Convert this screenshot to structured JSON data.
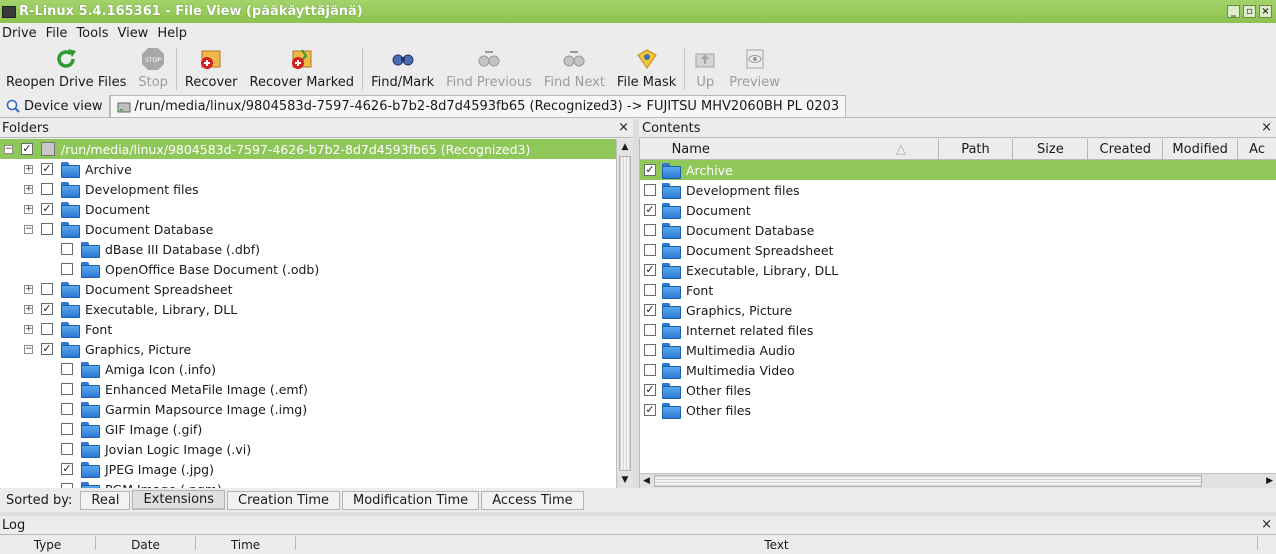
{
  "window": {
    "title": "R-Linux 5.4.165361 - File View (pääkäyttäjänä)"
  },
  "menu": [
    "Drive",
    "File",
    "Tools",
    "View",
    "Help"
  ],
  "toolbar": {
    "reopen": "Reopen Drive Files",
    "stop": "Stop",
    "recover": "Recover",
    "recover_marked": "Recover Marked",
    "find_mark": "Find/Mark",
    "find_previous": "Find Previous",
    "find_next": "Find Next",
    "file_mask": "File Mask",
    "up": "Up",
    "preview": "Preview"
  },
  "tabs": {
    "device_view": "Device view",
    "file_view": "/run/media/linux/9804583d-7597-4626-b7b2-8d7d4593fb65 (Recognized3) -> FUJITSU MHV2060BH PL 0203"
  },
  "folders": {
    "title": "Folders",
    "root": "/run/media/linux/9804583d-7597-4626-b7b2-8d7d4593fb65 (Recognized3)",
    "items": [
      {
        "label": "Archive",
        "level": 1,
        "expander": "+",
        "checked": true
      },
      {
        "label": "Development files",
        "level": 1,
        "expander": "+",
        "checked": false
      },
      {
        "label": "Document",
        "level": 1,
        "expander": "+",
        "checked": true
      },
      {
        "label": "Document Database",
        "level": 1,
        "expander": "-",
        "checked": false
      },
      {
        "label": "dBase III Database (.dbf)",
        "level": 2,
        "expander": "",
        "checked": false
      },
      {
        "label": "OpenOffice Base Document (.odb)",
        "level": 2,
        "expander": "",
        "checked": false
      },
      {
        "label": "Document Spreadsheet",
        "level": 1,
        "expander": "+",
        "checked": false
      },
      {
        "label": "Executable, Library, DLL",
        "level": 1,
        "expander": "+",
        "checked": true
      },
      {
        "label": "Font",
        "level": 1,
        "expander": "+",
        "checked": false
      },
      {
        "label": "Graphics, Picture",
        "level": 1,
        "expander": "-",
        "checked": true
      },
      {
        "label": "Amiga Icon (.info)",
        "level": 2,
        "expander": "",
        "checked": false
      },
      {
        "label": "Enhanced MetaFile Image (.emf)",
        "level": 2,
        "expander": "",
        "checked": false
      },
      {
        "label": "Garmin Mapsource Image (.img)",
        "level": 2,
        "expander": "",
        "checked": false
      },
      {
        "label": "GIF Image (.gif)",
        "level": 2,
        "expander": "",
        "checked": false
      },
      {
        "label": "Jovian Logic Image (.vi)",
        "level": 2,
        "expander": "",
        "checked": false
      },
      {
        "label": "JPEG Image (.jpg)",
        "level": 2,
        "expander": "",
        "checked": true
      },
      {
        "label": "PGM Image (.pgm)",
        "level": 2,
        "expander": "",
        "checked": false
      }
    ]
  },
  "contents": {
    "title": "Contents",
    "columns": [
      "Name",
      "Path",
      "Size",
      "Created",
      "Modified",
      "Ac"
    ],
    "rows": [
      {
        "name": "Archive",
        "checked": true,
        "selected": true
      },
      {
        "name": "Development files",
        "checked": false
      },
      {
        "name": "Document",
        "checked": true
      },
      {
        "name": "Document Database",
        "checked": false
      },
      {
        "name": "Document Spreadsheet",
        "checked": false
      },
      {
        "name": "Executable, Library, DLL",
        "checked": true
      },
      {
        "name": "Font",
        "checked": false
      },
      {
        "name": "Graphics, Picture",
        "checked": true
      },
      {
        "name": "Internet related files",
        "checked": false
      },
      {
        "name": "Multimedia Audio",
        "checked": false
      },
      {
        "name": "Multimedia Video",
        "checked": false
      },
      {
        "name": "Other files",
        "checked": true
      },
      {
        "name": "Other files",
        "checked": true
      }
    ]
  },
  "sort": {
    "label": "Sorted by:",
    "options": [
      "Real",
      "Extensions",
      "Creation Time",
      "Modification Time",
      "Access Time"
    ],
    "active": "Extensions"
  },
  "log": {
    "title": "Log",
    "columns": [
      "Type",
      "Date",
      "Time",
      "Text"
    ]
  }
}
